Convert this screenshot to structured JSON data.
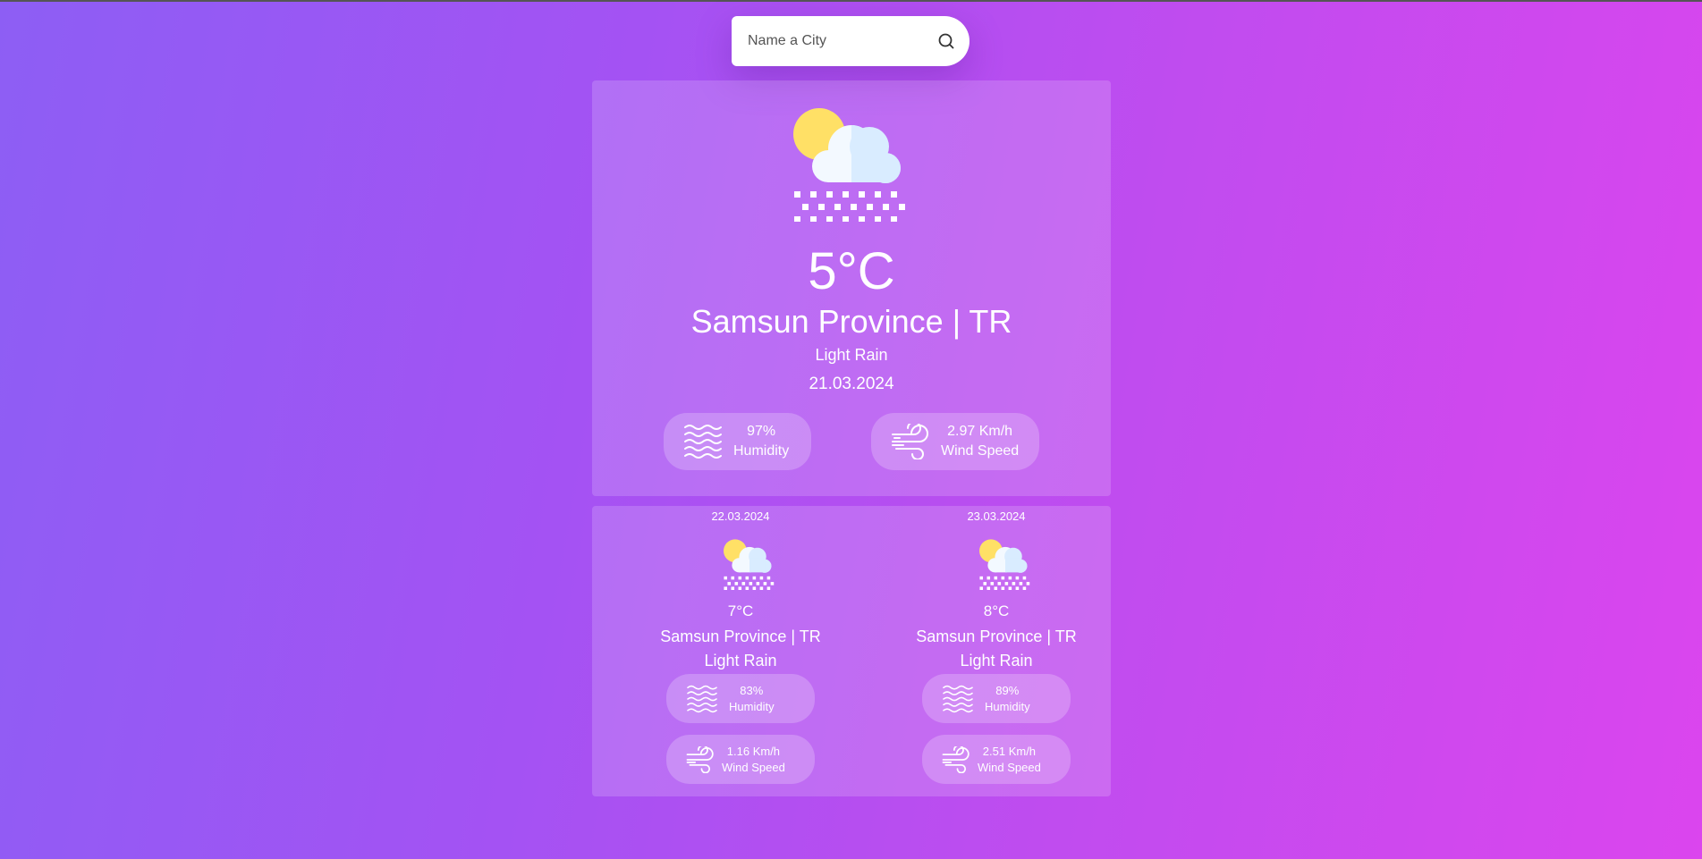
{
  "search": {
    "placeholder": "Name a City",
    "icon": "search-icon"
  },
  "current": {
    "icon": "sun-cloud-snow-icon",
    "temperature": "5°C",
    "location": "Samsun Province | TR",
    "description": "Light Rain",
    "date": "21.03.2024",
    "humidity": {
      "icon": "humidity-waves-icon",
      "value": "97%",
      "label": "Humidity"
    },
    "wind": {
      "icon": "wind-icon",
      "value": "2.97 Km/h",
      "label": "Wind Speed"
    }
  },
  "forecast": [
    {
      "date": "22.03.2024",
      "icon": "sun-cloud-snow-icon",
      "temperature": "7°C",
      "location": "Samsun Province | TR",
      "description": "Light Rain",
      "humidity": {
        "icon": "humidity-waves-icon",
        "value": "83%",
        "label": "Humidity"
      },
      "wind": {
        "icon": "wind-icon",
        "value": "1.16 Km/h",
        "label": "Wind Speed"
      }
    },
    {
      "date": "23.03.2024",
      "icon": "sun-cloud-snow-icon",
      "temperature": "8°C",
      "location": "Samsun Province | TR",
      "description": "Light Rain",
      "humidity": {
        "icon": "humidity-waves-icon",
        "value": "89%",
        "label": "Humidity"
      },
      "wind": {
        "icon": "wind-icon",
        "value": "2.51 Km/h",
        "label": "Wind Speed"
      }
    }
  ],
  "colors": {
    "background_start": "#8d5ef4",
    "background_end": "#db45ee",
    "sun": "#ffe066",
    "cloud": "#e8f4ff"
  }
}
